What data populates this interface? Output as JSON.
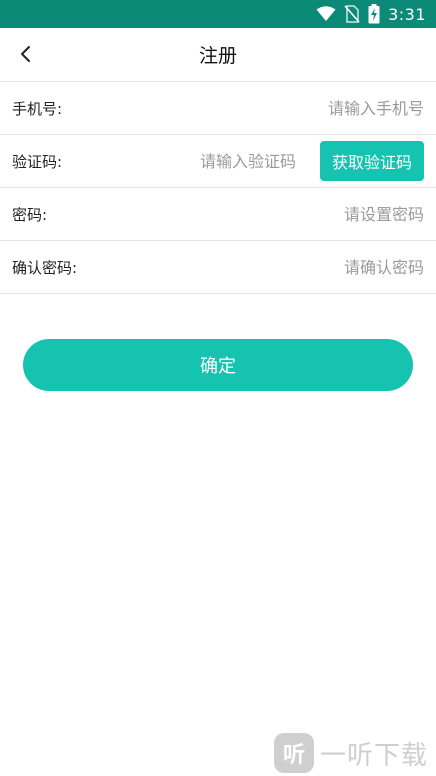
{
  "status_bar": {
    "time": "3:31",
    "background_color": "#0b8a78",
    "icons": [
      "wifi-icon",
      "no-sim-icon",
      "battery-charging-icon"
    ]
  },
  "header": {
    "back_icon": "chevron-left-icon",
    "title": "注册"
  },
  "form": {
    "phone": {
      "label": "手机号:",
      "placeholder": "请输入手机号",
      "value": ""
    },
    "code": {
      "label": "验证码:",
      "placeholder": "请输入验证码",
      "value": "",
      "button_label": "获取验证码"
    },
    "password": {
      "label": "密码:",
      "placeholder": "请设置密码",
      "value": ""
    },
    "confirm_password": {
      "label": "确认密码:",
      "placeholder": "请确认密码",
      "value": ""
    }
  },
  "confirm_button": {
    "label": "确定"
  },
  "accent_color": "#15c3b0",
  "watermark": {
    "logo_char": "听",
    "text": "一听下载"
  }
}
